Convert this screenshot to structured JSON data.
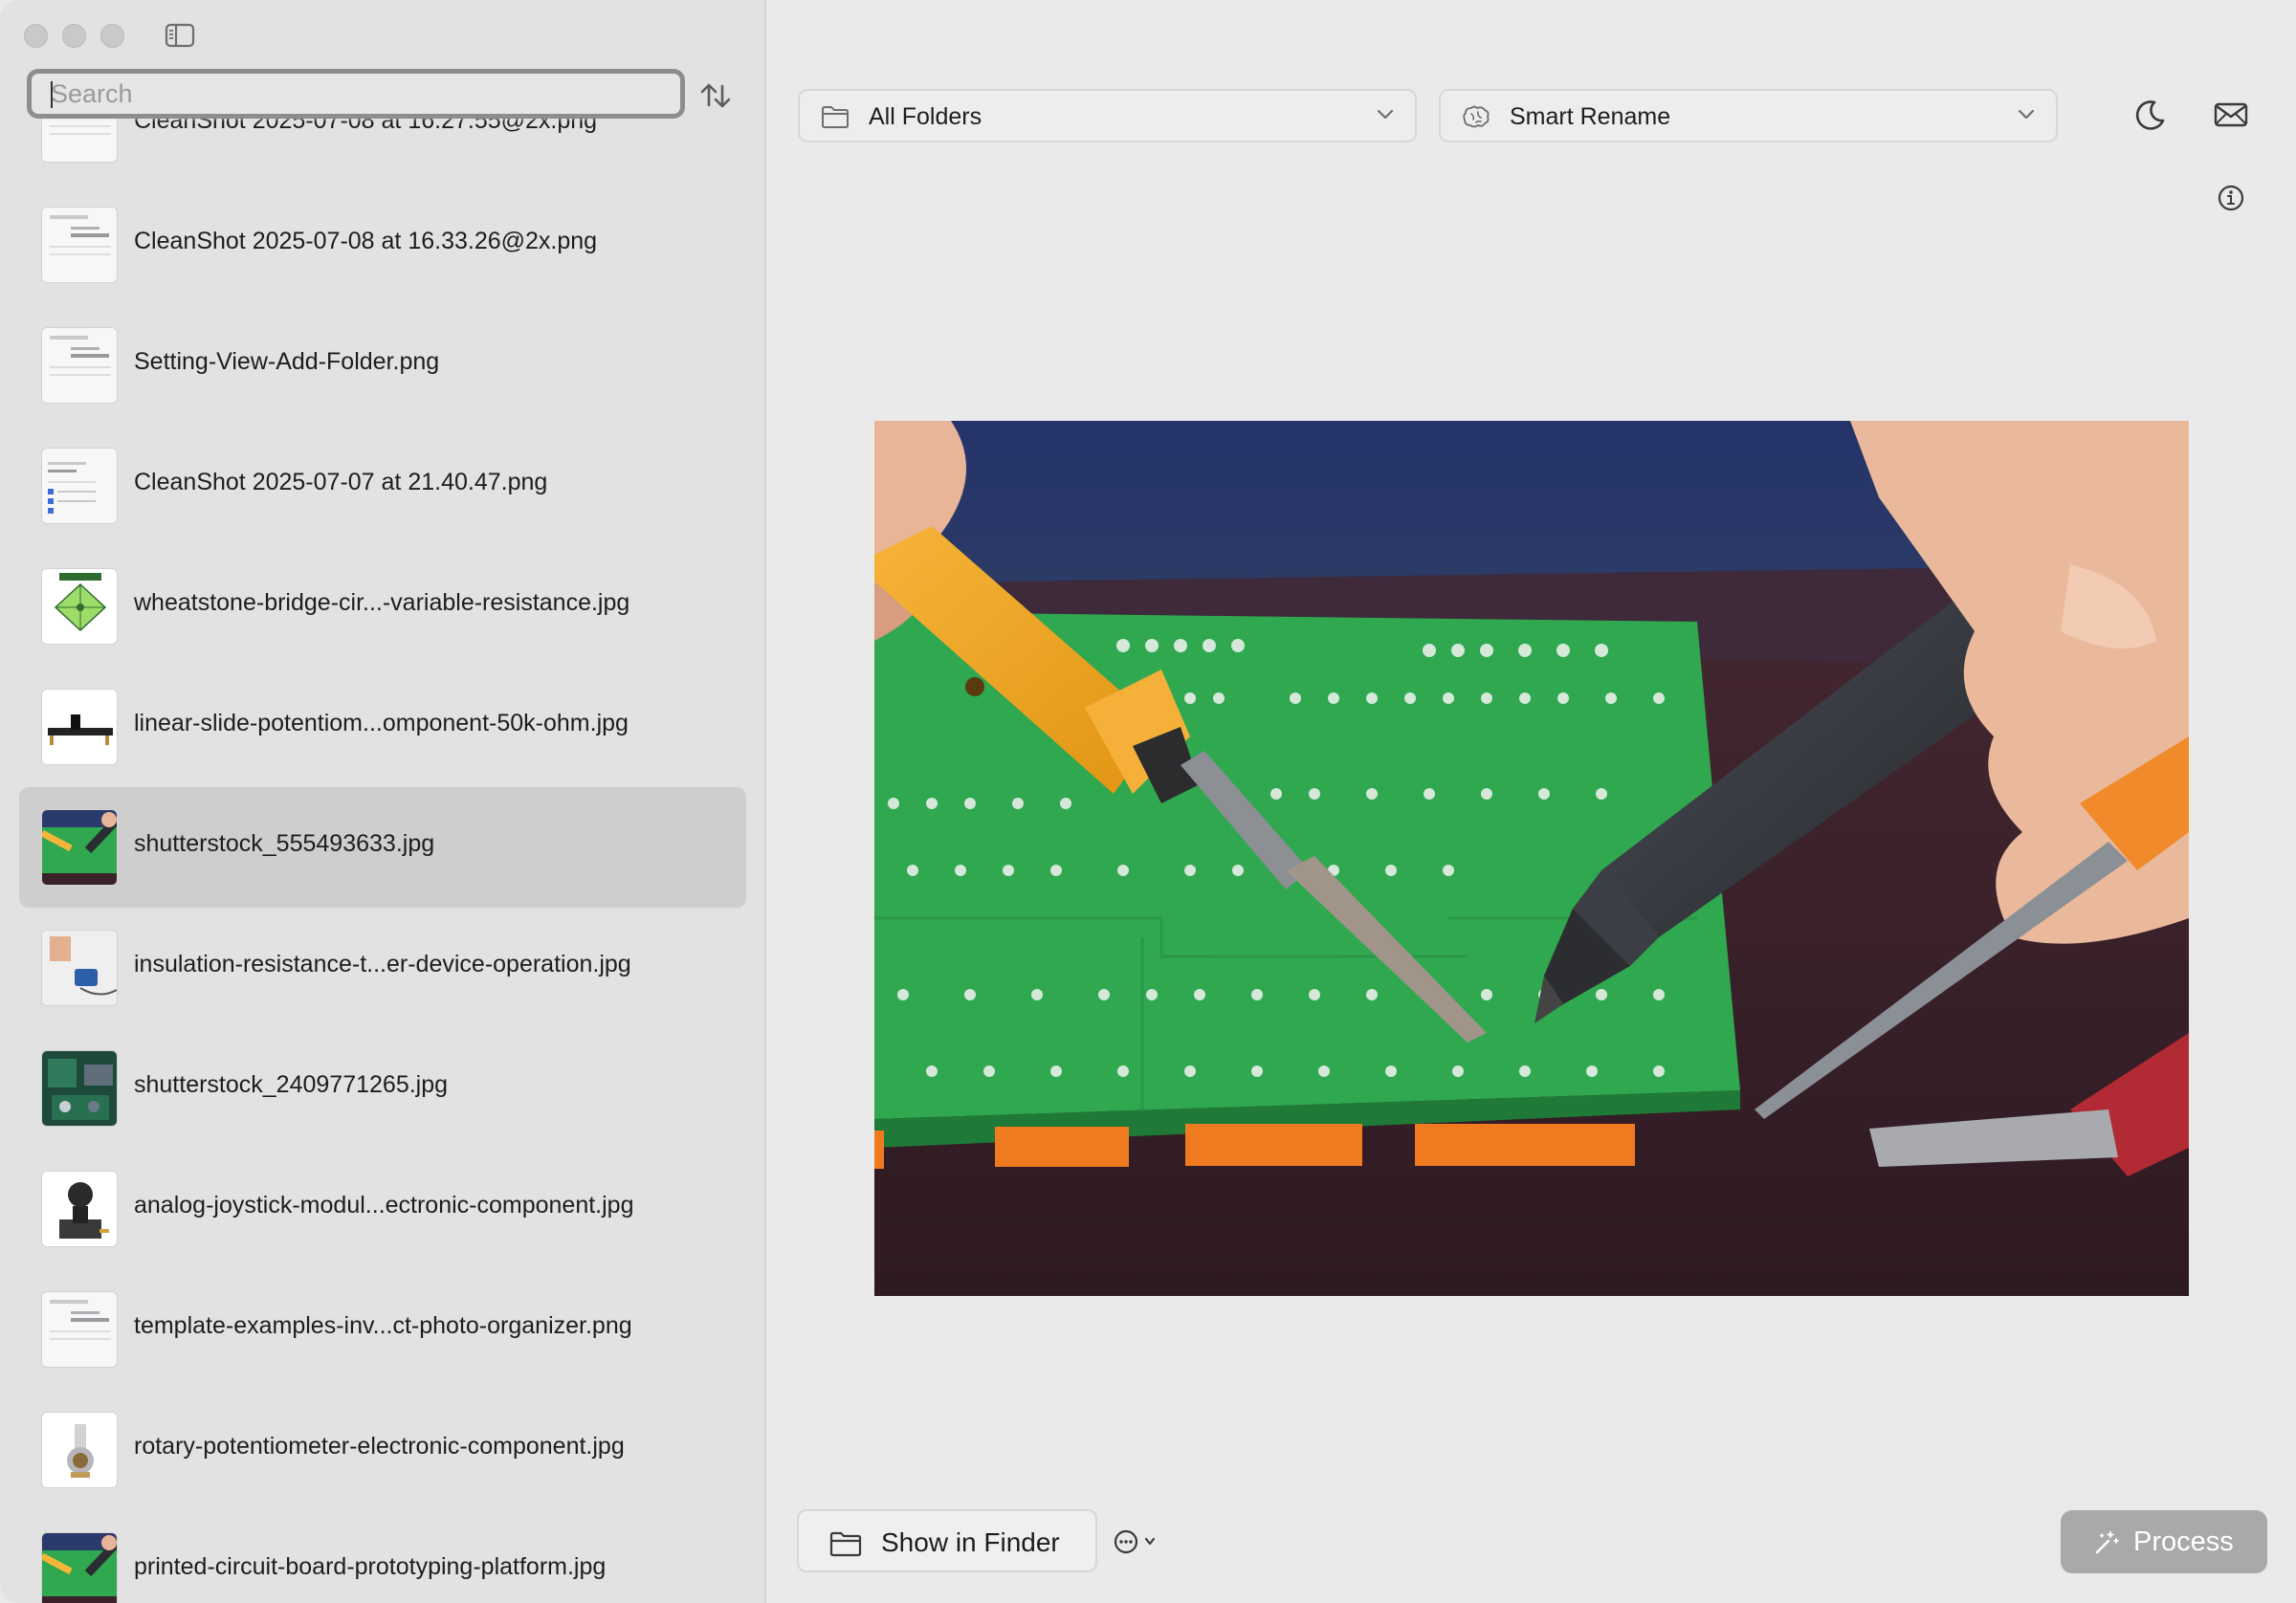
{
  "search": {
    "placeholder": "Search",
    "value": ""
  },
  "files": [
    {
      "name": "CleanShot 2025-07-08 at 16.27.55@2x.png",
      "thumb": "screenshot"
    },
    {
      "name": "CleanShot 2025-07-08 at 16.33.26@2x.png",
      "thumb": "screenshot"
    },
    {
      "name": "Setting-View-Add-Folder.png",
      "thumb": "screenshot"
    },
    {
      "name": "CleanShot 2025-07-07 at 21.40.47.png",
      "thumb": "screenshot-list"
    },
    {
      "name": "wheatstone-bridge-cir...-variable-resistance.jpg",
      "thumb": "diagram"
    },
    {
      "name": "linear-slide-potentiom...omponent-50k-ohm.jpg",
      "thumb": "slider"
    },
    {
      "name": "shutterstock_555493633.jpg",
      "thumb": "pcb",
      "selected": true
    },
    {
      "name": "insulation-resistance-t...er-device-operation.jpg",
      "thumb": "device"
    },
    {
      "name": "shutterstock_2409771265.jpg",
      "thumb": "pcb-dark"
    },
    {
      "name": "analog-joystick-modul...ectronic-component.jpg",
      "thumb": "joystick"
    },
    {
      "name": "template-examples-inv...ct-photo-organizer.png",
      "thumb": "screenshot"
    },
    {
      "name": "rotary-potentiometer-electronic-component.jpg",
      "thumb": "knob"
    },
    {
      "name": "printed-circuit-board-prototyping-platform.jpg",
      "thumb": "pcb"
    }
  ],
  "toolbar": {
    "folder_dropdown": {
      "label": "All Folders",
      "icon": "folder-icon"
    },
    "mode_dropdown": {
      "label": "Smart Rename",
      "icon": "brain-icon"
    },
    "right_icons": [
      "moon-icon",
      "envelope-icon",
      "info-icon"
    ]
  },
  "preview": {
    "subject": "soldering iron and desoldering pump on green circuit board"
  },
  "footer": {
    "show_in_finder_label": "Show in Finder",
    "more_menu_icon": "ellipsis-circle-icon",
    "process_label": "Process"
  },
  "colors": {
    "sidebar_bg": "#e2e2e3",
    "selection": "#cececf",
    "process_button": "#a9a9ac"
  }
}
